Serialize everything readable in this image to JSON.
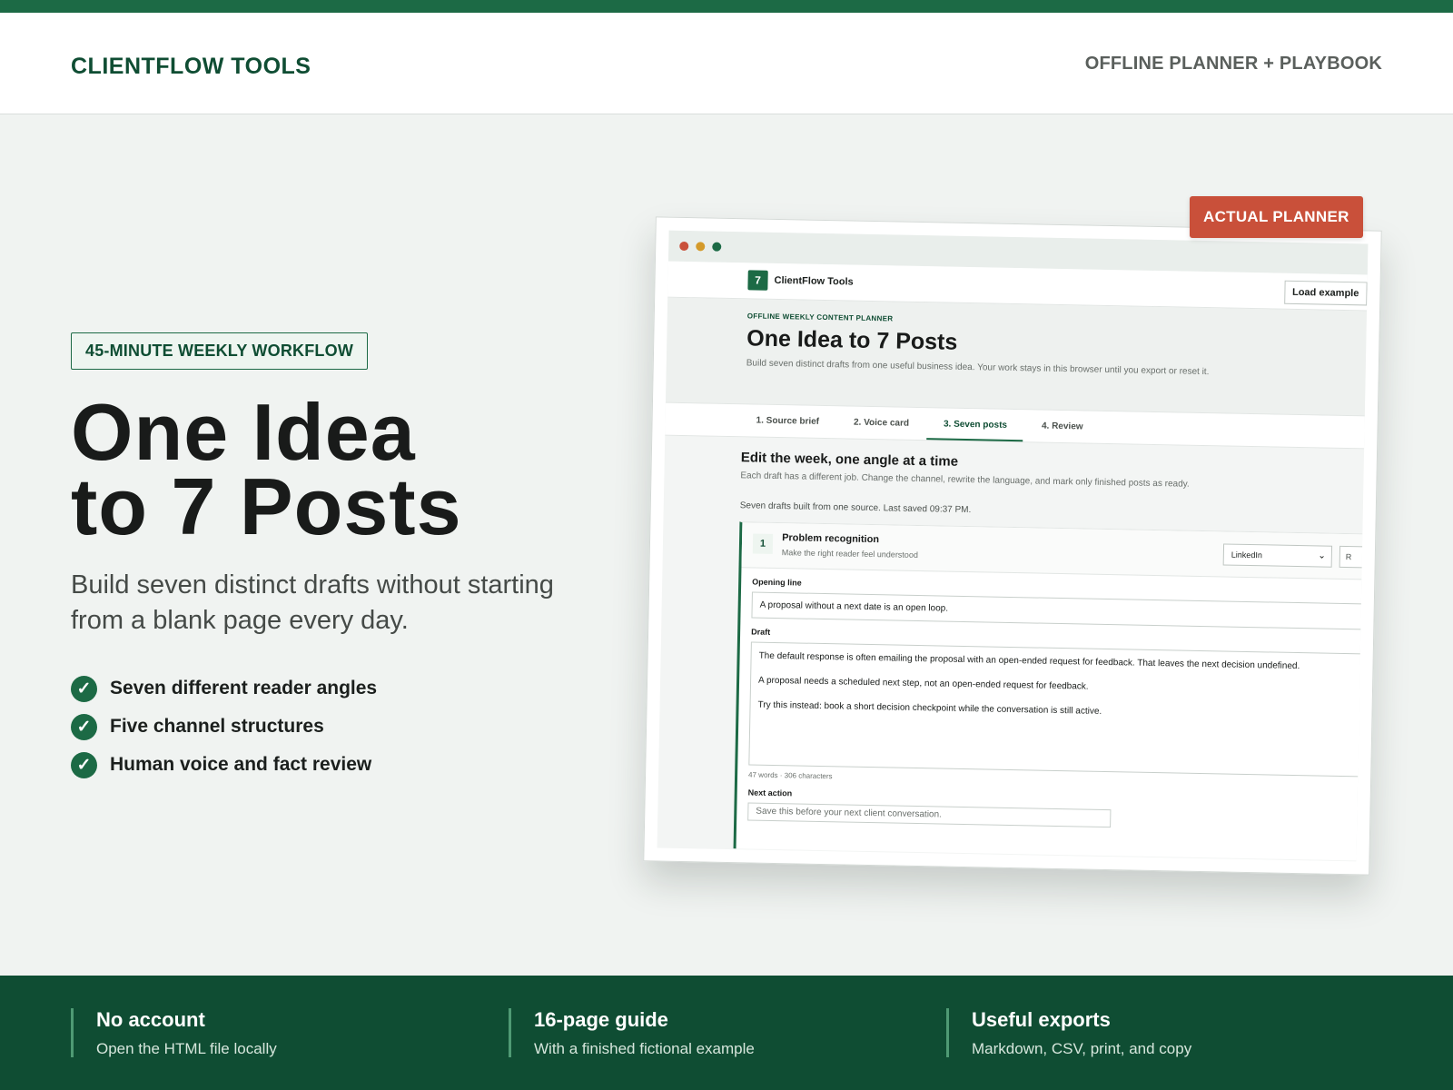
{
  "header": {
    "brand": "CLIENTFLOW TOOLS",
    "tagline": "OFFLINE PLANNER + PLAYBOOK"
  },
  "hero": {
    "pill": "45-MINUTE WEEKLY WORKFLOW",
    "title_line1": "One Idea",
    "title_line2": "to 7 Posts",
    "subtitle": "Build seven distinct drafts without starting from a blank page every day.",
    "features": [
      {
        "label": "Seven different reader angles"
      },
      {
        "label": "Five channel structures"
      },
      {
        "label": "Human voice and fact review"
      }
    ]
  },
  "badge": "ACTUAL PLANNER",
  "planner": {
    "logo_number": "7",
    "logo_text": "ClientFlow Tools",
    "load_button": "Load example",
    "eyebrow": "OFFLINE WEEKLY CONTENT PLANNER",
    "title": "One Idea to 7 Posts",
    "description": "Build seven distinct drafts from one useful business idea. Your work stays in this browser until you export or reset it.",
    "tabs": [
      {
        "label": "1. Source brief"
      },
      {
        "label": "2. Voice card"
      },
      {
        "label": "3. Seven posts",
        "active": true
      },
      {
        "label": "4. Review"
      }
    ],
    "edit_title": "Edit the week, one angle at a time",
    "edit_desc": "Each draft has a different job. Change the channel, rewrite the language, and mark only finished posts as ready.",
    "saved_status": "Seven drafts built from one source. Last saved 09:37 PM.",
    "card": {
      "number": "1",
      "title": "Problem recognition",
      "subtitle": "Make the right reader feel understood",
      "channel": "LinkedIn",
      "side_button": "R",
      "opening_label": "Opening line",
      "opening_value": "A proposal without a next date is an open loop.",
      "draft_label": "Draft",
      "draft_p1": "The default response is often emailing the proposal with an open-ended request for feedback. That leaves the next decision undefined.",
      "draft_p2": "A proposal needs a scheduled next step, not an open-ended request for feedback.",
      "draft_p3": "Try this instead: book a short decision checkpoint while the conversation is still active.",
      "counts": "47 words · 306 characters",
      "next_label": "Next action",
      "next_value": "Save this before your next client conversation."
    }
  },
  "footer": [
    {
      "title": "No account",
      "desc": "Open the HTML file locally"
    },
    {
      "title": "16-page guide",
      "desc": "With a finished fictional example"
    },
    {
      "title": "Useful exports",
      "desc": "Markdown, CSV, print, and copy"
    }
  ],
  "colors": {
    "brand_green": "#1c6a45",
    "dark_green": "#0f4d33",
    "badge_red": "#c9503a",
    "background": "#f0f3f1"
  }
}
